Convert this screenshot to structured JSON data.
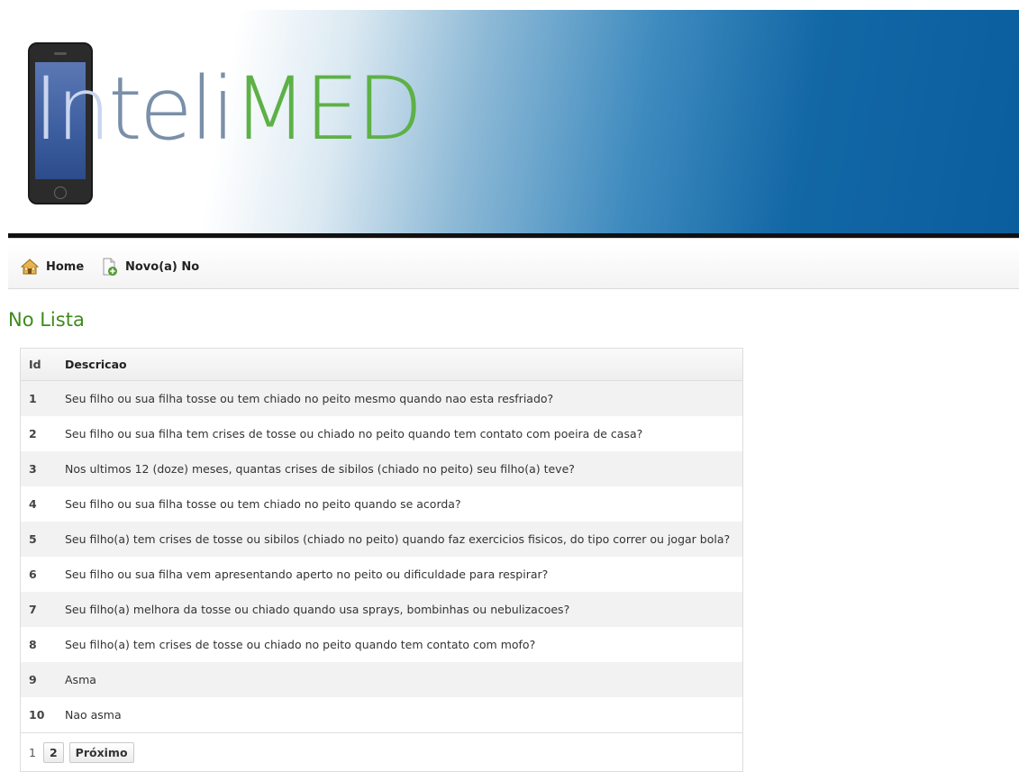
{
  "header": {
    "logo_part_in": "In",
    "logo_part_teli": "teli",
    "logo_part_med": "MED"
  },
  "nav": {
    "home_label": "Home",
    "new_label": "Novo(a) No"
  },
  "page": {
    "title": "No Lista"
  },
  "table": {
    "headers": {
      "id": "Id",
      "description": "Descricao"
    },
    "rows": [
      {
        "id": "1",
        "description": "Seu filho ou sua filha tosse ou tem chiado no peito mesmo quando nao esta resfriado?"
      },
      {
        "id": "2",
        "description": "Seu filho ou sua filha tem crises de tosse ou chiado no peito quando tem contato com poeira de casa?"
      },
      {
        "id": "3",
        "description": "Nos ultimos 12 (doze) meses, quantas crises de sibilos (chiado no peito) seu filho(a) teve?"
      },
      {
        "id": "4",
        "description": "Seu filho ou sua filha tosse ou tem chiado no peito quando se acorda?"
      },
      {
        "id": "5",
        "description": "Seu filho(a) tem crises de tosse ou sibilos (chiado no peito) quando faz exercicios fisicos, do tipo correr ou jogar bola?"
      },
      {
        "id": "6",
        "description": "Seu filho ou sua filha vem apresentando aperto no peito ou dificuldade para respirar?"
      },
      {
        "id": "7",
        "description": "Seu filho(a) melhora da tosse ou chiado quando usa sprays, bombinhas ou nebulizacoes?"
      },
      {
        "id": "8",
        "description": "Seu filho(a) tem crises de tosse ou chiado no peito quando tem contato com mofo?"
      },
      {
        "id": "9",
        "description": "Asma"
      },
      {
        "id": "10",
        "description": "Nao asma"
      }
    ]
  },
  "pagination": {
    "current": "1",
    "page_2": "2",
    "next_label": "Próximo"
  },
  "colors": {
    "title_green": "#3e8a1c",
    "banner_blue": "#0b5e9e",
    "logo_green": "#5db146"
  }
}
